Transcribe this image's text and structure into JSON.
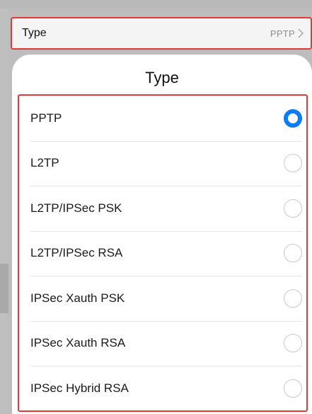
{
  "settings_row": {
    "label": "Type",
    "value": "PPTP"
  },
  "sheet": {
    "title": "Type"
  },
  "options": [
    {
      "label": "PPTP",
      "selected": true
    },
    {
      "label": "L2TP",
      "selected": false
    },
    {
      "label": "L2TP/IPSec PSK",
      "selected": false
    },
    {
      "label": "L2TP/IPSec RSA",
      "selected": false
    },
    {
      "label": "IPSec Xauth PSK",
      "selected": false
    },
    {
      "label": "IPSec Xauth RSA",
      "selected": false
    },
    {
      "label": "IPSec Hybrid RSA",
      "selected": false
    }
  ],
  "colors": {
    "accent": "#0a7cf5",
    "highlight_border": "#e53935"
  }
}
